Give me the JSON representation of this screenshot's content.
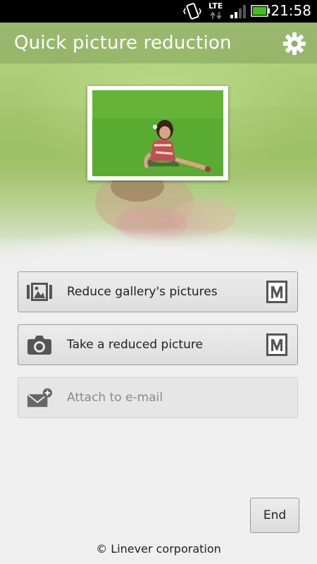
{
  "status_bar": {
    "network": "LTE",
    "time": "21:58",
    "icons": [
      "vibrate-icon",
      "lte-icon",
      "signal-icon",
      "battery-icon"
    ]
  },
  "app": {
    "title": "Quick picture reduction",
    "settings_icon": "gear-icon"
  },
  "menu": {
    "items": [
      {
        "label": "Reduce gallery's pictures",
        "icon": "gallery-icon",
        "badge_icon": "m-size-icon",
        "enabled": true
      },
      {
        "label": "Take a reduced picture",
        "icon": "camera-icon",
        "badge_icon": "m-size-icon",
        "enabled": true
      },
      {
        "label": "Attach to e-mail",
        "icon": "mail-add-icon",
        "enabled": false
      }
    ]
  },
  "footer": {
    "end_label": "End",
    "copyright": "© Linever corporation"
  },
  "colors": {
    "title_text": "#ffffff",
    "action_bar": "#82a05a",
    "button_border": "#9a9a9a",
    "disabled_text": "#8a8a8a"
  }
}
